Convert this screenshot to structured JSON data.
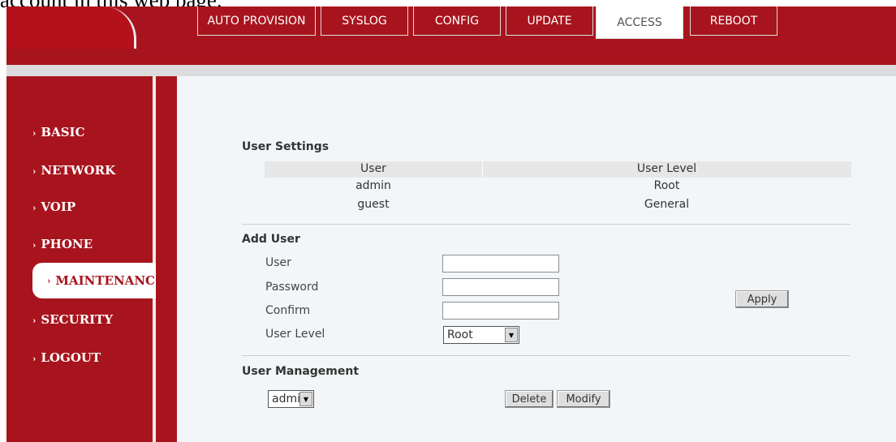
{
  "caption_text": "account in this web page.",
  "tabs": [
    {
      "label": "AUTO PROVISION",
      "active": false
    },
    {
      "label": "SYSLOG",
      "active": false
    },
    {
      "label": "CONFIG",
      "active": false
    },
    {
      "label": "UPDATE",
      "active": false
    },
    {
      "label": "ACCESS",
      "active": true
    },
    {
      "label": "REBOOT",
      "active": false
    }
  ],
  "sidebar": {
    "items": [
      {
        "label": "BASIC"
      },
      {
        "label": "NETWORK"
      },
      {
        "label": "VOIP"
      },
      {
        "label": "PHONE"
      },
      {
        "label": "MAINTENANC",
        "active": true
      },
      {
        "label": "SECURITY"
      },
      {
        "label": "LOGOUT"
      }
    ],
    "chevron": "›"
  },
  "user_settings": {
    "title": "User Settings",
    "columns": [
      "User",
      "User Level"
    ],
    "rows": [
      [
        "admin",
        "Root"
      ],
      [
        "guest",
        "General"
      ]
    ]
  },
  "add_user": {
    "title": "Add User",
    "user_label": "User",
    "password_label": "Password",
    "confirm_label": "Confirm",
    "level_label": "User Level",
    "level_value": "Root",
    "apply_label": "Apply"
  },
  "user_management": {
    "title": "User Management",
    "selected_user": "admin",
    "delete_label": "Delete",
    "modify_label": "Modify"
  },
  "colors": {
    "brand_red": "#a8141d",
    "content_bg": "#f3f6f8"
  },
  "icons": {
    "dropdown": "dropdown-arrow-icon",
    "chevron": "chevron-right-icon"
  }
}
